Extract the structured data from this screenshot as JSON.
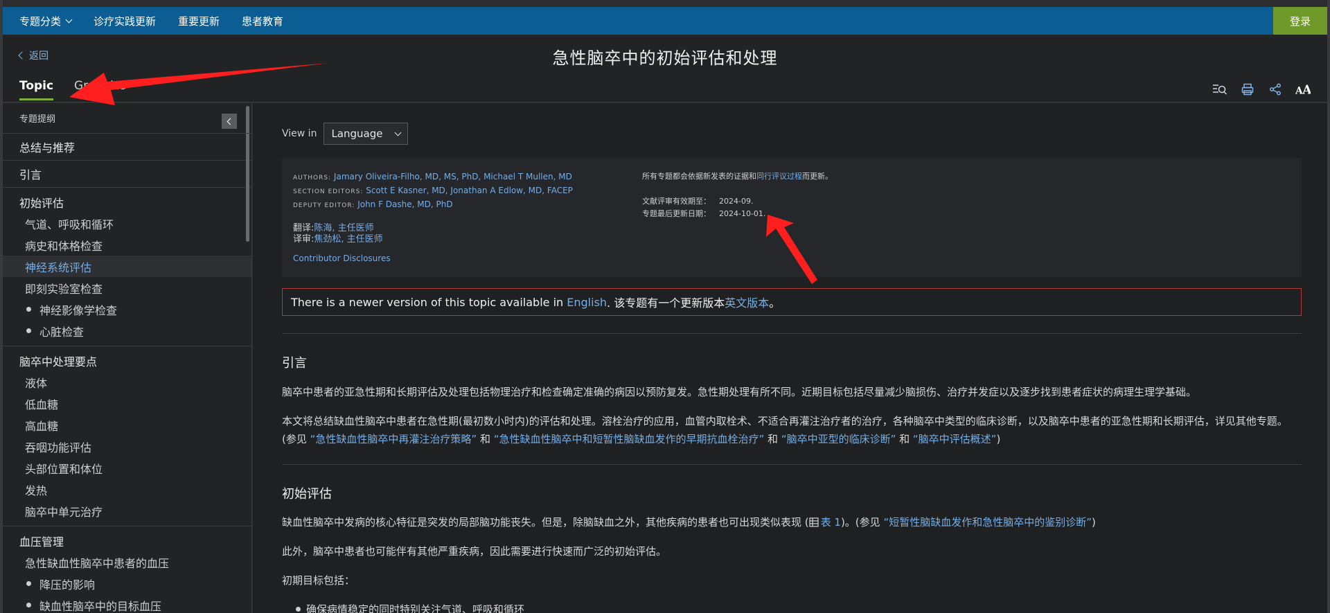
{
  "nav": {
    "items": [
      "专题分类",
      "诊疗实践更新",
      "重要更新",
      "患者教育"
    ],
    "login": "登录"
  },
  "header": {
    "back": "返回",
    "title": "急性脑卒中的初始评估和处理",
    "tabs": [
      "Topic",
      "Graphics"
    ]
  },
  "sidebar": {
    "heading": "专题提纲",
    "items": {
      "summary": "总结与推荐",
      "intro": "引言",
      "initial": "初始评估",
      "airway": "气道、呼吸和循环",
      "history": "病史和体格检查",
      "neuro": "神经系统评估",
      "lab": "即刻实验室检查",
      "imaging": "神经影像学检查",
      "cardiac": "心脏检查",
      "mgmt": "脑卒中处理要点",
      "fluids": "液体",
      "hypo": "低血糖",
      "hyper": "高血糖",
      "swallow": "吞咽功能评估",
      "headpos": "头部位置和体位",
      "fever": "发热",
      "unit": "脑卒中单元治疗",
      "bp": "血压管理",
      "bp_acute": "急性缺血性脑卒中患者的血压",
      "bp_effect": "降压的影响",
      "bp_target": "缺血性脑卒中的目标血压"
    }
  },
  "main": {
    "view_in": "View in",
    "language": "Language",
    "meta": {
      "authors_label": "Authors:",
      "authors": "Jamary Oliveira-Filho, MD, MS, PhD, Michael T Mullen, MD",
      "section_editors_label": "Section Editors:",
      "section_editors": "Scott E Kasner, MD, Jonathan A Edlow, MD, FACEP",
      "deputy_editor_label": "Deputy Editor:",
      "deputy_editor": "John F Dashe, MD, PhD",
      "translator_label": "翻译:",
      "translator": "陈海, 主任医师",
      "reviewer_label": "译审:",
      "reviewer": "焦劲松, 主任医师",
      "disclosures": "Contributor Disclosures",
      "update_note_a": "所有专题都会依据新发表的证据和",
      "update_note_link": "同行评议过程",
      "update_note_b": "而更新。",
      "lit_label": "文献评审有效期至：",
      "lit_value": "2024-09.",
      "last_label": "专题最后更新日期：",
      "last_value": "2024-10-01."
    },
    "notice": {
      "a": "There is a newer version of this topic available in ",
      "link1": "English",
      "b": ". 该专题有一个更新版本",
      "link2": "英文版本",
      "c": "。"
    },
    "intro_heading": "引言",
    "intro_p1": "脑卒中患者的亚急性期和长期评估及处理包括物理治疗和检查确定准确的病因以预防复发。急性期处理有所不同。近期目标包括尽量减少脑损伤、治疗并发症以及逐步找到患者症状的病理生理学基础。",
    "intro_p2_a": "本文将总结缺血性脑卒中患者在急性期(最初数小时内)的评估和处理。溶栓治疗的应用，血管内取栓术、不适合再灌注治疗者的治疗，各种脑卒中类型的临床诊断，以及脑卒中患者的亚急性期和长期评估，详见其他专题。(参见 ",
    "intro_p2_l1": "“急性缺血性脑卒中再灌注治疗策略”",
    "intro_p2_and1": " 和 ",
    "intro_p2_l2": "“急性缺血性脑卒中和短暂性脑缺血发作的早期抗血栓治疗”",
    "intro_p2_and2": " 和 ",
    "intro_p2_l3": "“脑卒中亚型的临床诊断”",
    "intro_p2_and3": " 和 ",
    "intro_p2_l4": "“脑卒中评估概述”",
    "intro_p2_end": ")",
    "initial_heading": "初始评估",
    "initial_p1_a": "缺血性脑卒中发病的核心特征是突发的局部脑功能丧失。但是，除脑缺血之外，其他疾病的患者也可出现类似表现 (",
    "initial_p1_table": "表 1",
    "initial_p1_b": ")。(参见 ",
    "initial_p1_link": "“短暂性脑缺血发作和急性脑卒中的鉴别诊断”",
    "initial_p1_c": ")",
    "initial_p2": "此外，脑卒中患者也可能伴有其他严重疾病，因此需要进行快速而广泛的初始评估。",
    "initial_p3": "初期目标包括：",
    "initial_li1": "确保病情稳定的同时特别关注气道、呼吸和循环"
  }
}
